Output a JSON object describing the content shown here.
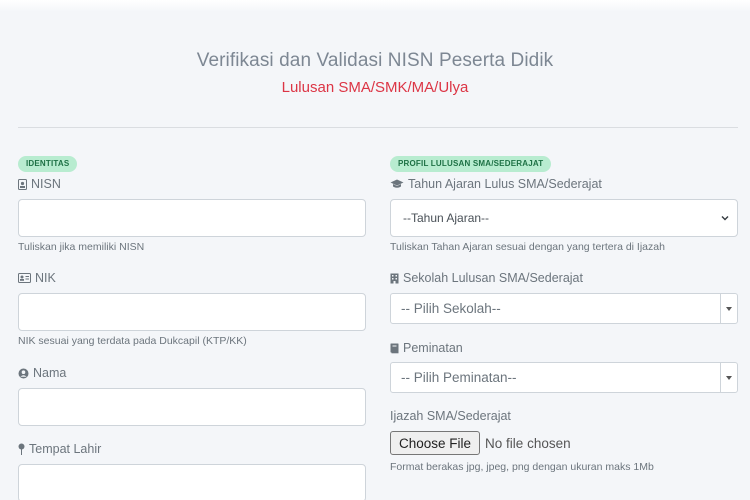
{
  "header": {
    "title": "Verifikasi dan Validasi NISN Peserta Didik",
    "subtitle": "Lulusan SMA/SMK/MA/Ulya"
  },
  "left": {
    "badge": "IDENTITAS",
    "nisn": {
      "label": "NISN",
      "value": "",
      "help": "Tuliskan jika memiliki NISN",
      "icon": "id-badge-icon"
    },
    "nik": {
      "label": "NIK",
      "value": "",
      "help": "NIK sesuai yang terdata pada Dukcapil (KTP/KK)",
      "icon": "id-card-icon"
    },
    "nama": {
      "label": "Nama",
      "value": "",
      "icon": "user-circle-icon"
    },
    "tempat_lahir": {
      "label": "Tempat Lahir",
      "value": "",
      "icon": "map-pin-icon"
    }
  },
  "right": {
    "badge": "PROFIL LULUSAN SMA/SEDERAJAT",
    "tahun_ajaran": {
      "label": "Tahun Ajaran Lulus SMA/Sederajat",
      "selected": "--Tahun Ajaran--",
      "help": "Tuliskan Tahan Ajaran sesuai dengan yang tertera di Ijazah",
      "icon": "graduation-cap-icon"
    },
    "sekolah": {
      "label": "Sekolah Lulusan SMA/Sederajat",
      "selected": "-- Pilih Sekolah--",
      "icon": "building-icon"
    },
    "peminatan": {
      "label": "Peminatan",
      "selected": "-- Pilih Peminatan--",
      "icon": "book-icon"
    },
    "ijazah": {
      "label": "Ijazah SMA/Sederajat",
      "button": "Choose File",
      "status": "No file chosen",
      "help": "Format berakas jpg, jpeg, png dengan ukuran maks 1Mb"
    }
  },
  "colors": {
    "accent_red": "#dc3545",
    "badge_bg": "#b8ecd0",
    "badge_text": "#1e7145"
  }
}
